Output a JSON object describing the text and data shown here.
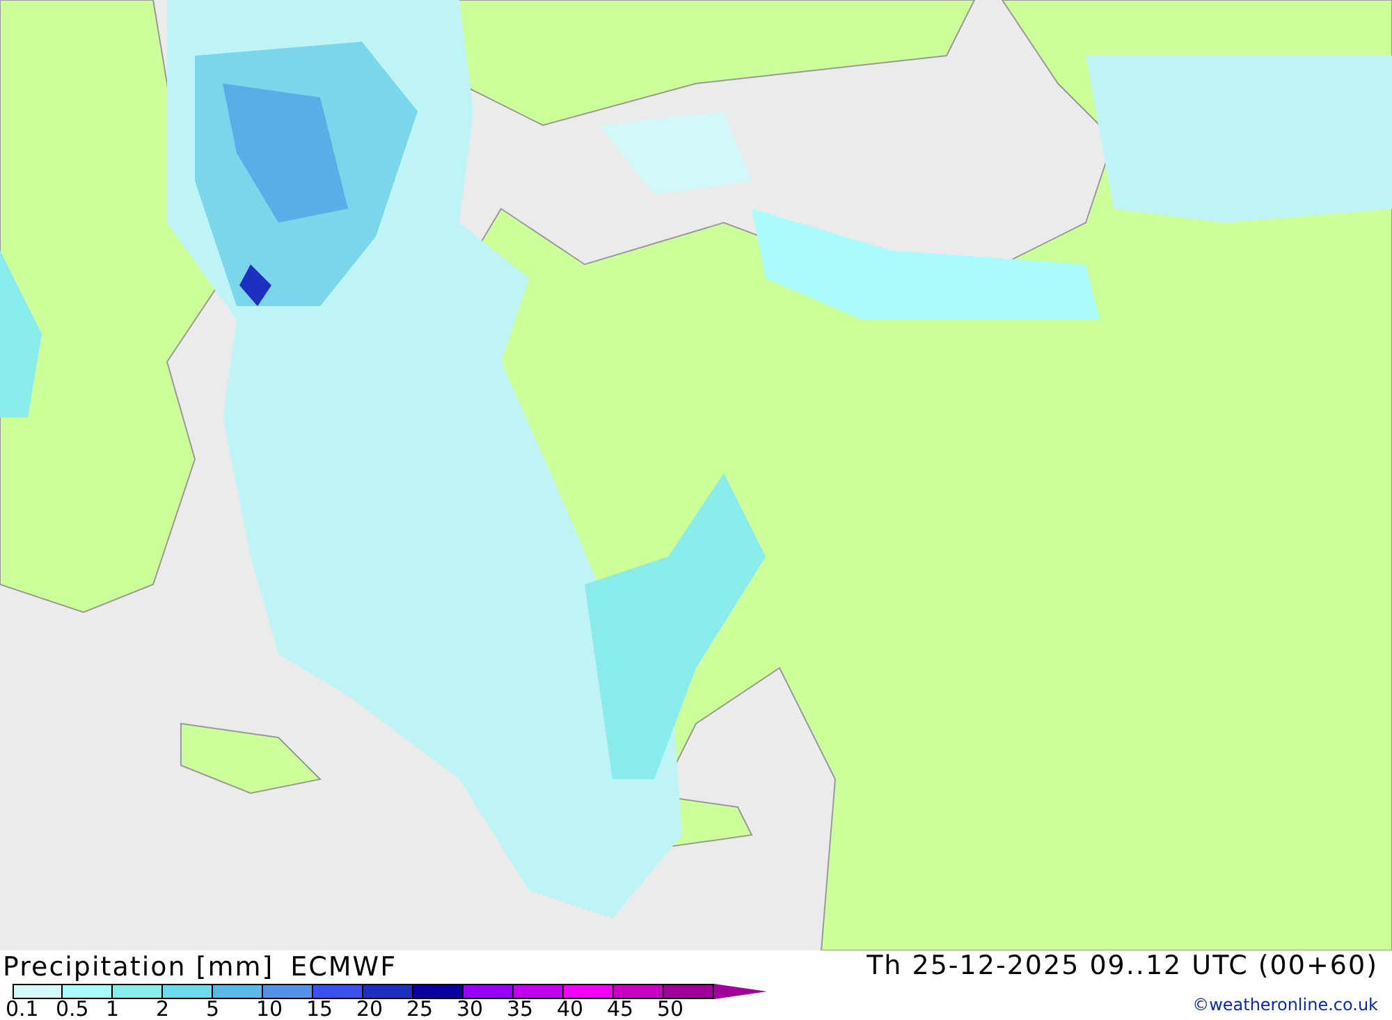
{
  "map": {
    "title": "Precipitation [mm]",
    "model": "ECMWF",
    "valid_time": "Th 25-12-2025 09..12 UTC (00+60)",
    "credit": "©weatheronline.co.uk"
  },
  "legend": [
    {
      "label": "0.1",
      "color": "#d4f8f8"
    },
    {
      "label": "0.5",
      "color": "#aafcfc"
    },
    {
      "label": "1",
      "color": "#8aecea"
    },
    {
      "label": "2",
      "color": "#6cd8ea"
    },
    {
      "label": "5",
      "color": "#5ab8e8"
    },
    {
      "label": "10",
      "color": "#5492e8"
    },
    {
      "label": "15",
      "color": "#3a52f2"
    },
    {
      "label": "20",
      "color": "#1e30c0"
    },
    {
      "label": "25",
      "color": "#0a00a0"
    },
    {
      "label": "30",
      "color": "#9800f8"
    },
    {
      "label": "35",
      "color": "#c000ea"
    },
    {
      "label": "40",
      "color": "#f000f8"
    },
    {
      "label": "45",
      "color": "#c800c0"
    },
    {
      "label": "50",
      "color": "#a0009a"
    }
  ]
}
